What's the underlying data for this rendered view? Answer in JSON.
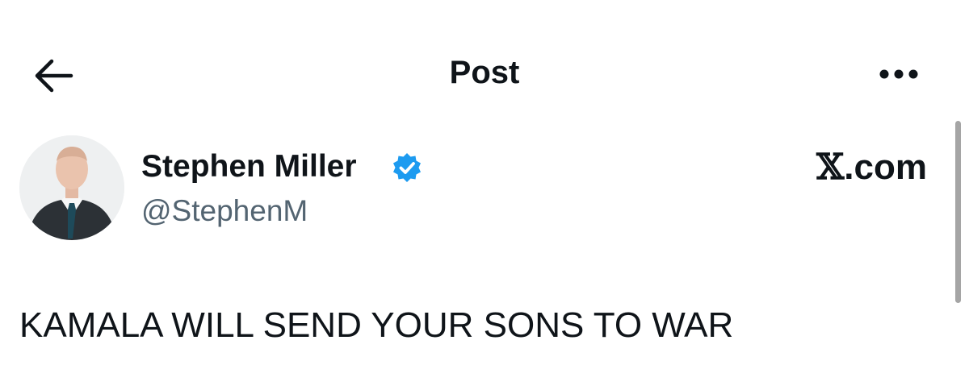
{
  "header": {
    "title": "Post",
    "back_icon": "arrow-left-icon",
    "more_icon": "more-horizontal-icon"
  },
  "post": {
    "author": {
      "name": "Stephen Miller",
      "handle": "@StephenM",
      "verified_icon": "verified-badge-icon",
      "verified_color": "#1d9bf0"
    },
    "brand_x": "𝕏",
    "brand_suffix": ".com",
    "text": "KAMALA WILL SEND YOUR SONS TO WAR"
  },
  "colors": {
    "text_primary": "#0f1419",
    "text_secondary": "#536471",
    "background": "#ffffff"
  }
}
